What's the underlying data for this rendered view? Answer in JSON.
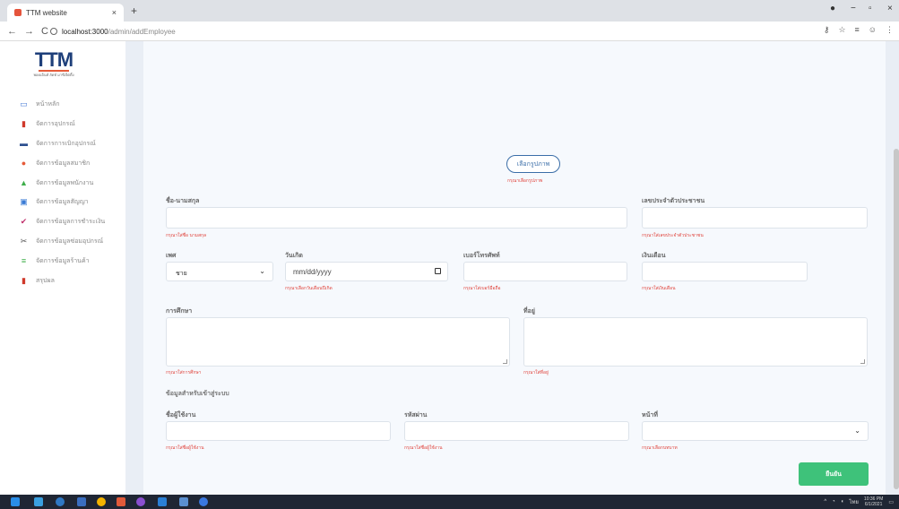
{
  "browser": {
    "tab_title": "TTM website",
    "tab_close": "×",
    "new_tab": "+",
    "win_min": "−",
    "win_max": "▫",
    "win_close": "×",
    "back": "←",
    "forward": "→",
    "reload": "C",
    "url_host": "localhost:3000",
    "url_path": "/admin/addEmployee"
  },
  "logo": {
    "mark": "TTM",
    "subtitle": "พอดเอ็นท์ ลัดท์ มาชีเจ็ตติ้ง"
  },
  "sidebar": {
    "items": [
      {
        "label": "หน้าหลัก",
        "icon": "monitor-icon",
        "color": "#4a7bd6"
      },
      {
        "label": "จัดการอุปกรณ์",
        "icon": "equipment-icon",
        "color": "#d0392b"
      },
      {
        "label": "จัดการการเบิกอุปกรณ์",
        "icon": "box-icon",
        "color": "#2c4f8f"
      },
      {
        "label": "จัดการข้อมูลสมาชิก",
        "icon": "member-icon",
        "color": "#e65b3a"
      },
      {
        "label": "จัดการข้อมูลพนักงาน",
        "icon": "employee-icon",
        "color": "#3fae4a"
      },
      {
        "label": "จัดการข้อมูลสัญญา",
        "icon": "contract-icon",
        "color": "#3a7bd5"
      },
      {
        "label": "จัดการข้อมูลการชำระเงิน",
        "icon": "check-icon",
        "color": "#c02f6b"
      },
      {
        "label": "จัดการข้อมูลซ่อมอุปกรณ์",
        "icon": "tools-icon",
        "color": "#555555"
      },
      {
        "label": "จัดการข้อมูลร้านค้า",
        "icon": "store-icon",
        "color": "#3fae4a"
      },
      {
        "label": "สรุปผล",
        "icon": "chart-icon",
        "color": "#d0392b"
      }
    ]
  },
  "form": {
    "choose_image_button": "เลือกรูปภาพ",
    "choose_image_error": "กรุณาเลือกรูปภาพ",
    "name_label": "ชื่อ-นามสกุล",
    "name_error": "กรุณาใส่ชื่อ นามสกุล",
    "id_label": "เลขประจำตัวประชาชน",
    "id_error": "กรุณาใส่เลขประจำตัวประชาชน",
    "gender_label": "เพศ",
    "gender_value": "ชาย",
    "birthday_label": "วันเกิด",
    "birthday_placeholder": "mm/dd/yyyy",
    "birthday_error": "กรุณาเลือกวันเดือนปีเกิด",
    "phone_label": "เบอร์โทรศัพท์",
    "phone_error": "กรุณาใส่เบอร์มือถือ",
    "salary_label": "เงินเดือน",
    "salary_error": "กรุณาใส่เงินเดือน",
    "education_label": "การศึกษา",
    "education_error": "กรุณาใส่การศึกษา",
    "address_label": "ที่อยู่",
    "address_error": "กรุณาใส่ที่อยู่",
    "login_section": "ข้อมูลสำหรับเข้าสู่ระบบ",
    "username_label": "ชื่อผู้ใช้งาน",
    "username_error": "กรุณาใส่ชื่อผู้ใช้งาน",
    "password_label": "รหัสผ่าน",
    "password_error": "กรุณาใส่ชื่อผู้ใช้งาน",
    "position_label": "หน้าที่",
    "position_error": "กรุณาเลือกบทบาท",
    "submit_button": "ยืนยัน"
  },
  "taskbar": {
    "time": "10:36 PM",
    "date": "6/1/2021",
    "lang": "ไทย"
  }
}
